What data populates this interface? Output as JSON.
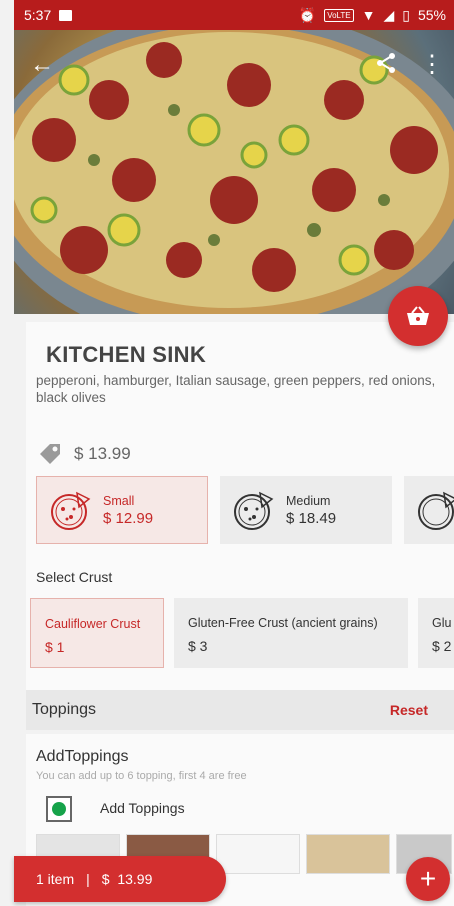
{
  "status_bar": {
    "time": "5:37",
    "volte": "VoLTE",
    "battery": "55%"
  },
  "header": {
    "back_icon": "arrow-back-icon",
    "share_icon": "share-icon",
    "more_icon": "more-vert-icon"
  },
  "product": {
    "name": "KITCHEN SINK",
    "description": "pepperoni, hamburger, Italian sausage, green peppers, red onions, black olives",
    "base_price": "$ 13.99"
  },
  "sizes": [
    {
      "name": "Small",
      "price": "$ 12.99",
      "selected": true
    },
    {
      "name": "Medium",
      "price": "$ 18.49",
      "selected": false
    },
    {
      "name": "",
      "price": "",
      "selected": false
    }
  ],
  "crust": {
    "label": "Select Crust",
    "options": [
      {
        "name": "Cauliflower Crust",
        "price": "$ 1",
        "selected": true
      },
      {
        "name": "Gluten-Free Crust (ancient grains)",
        "price": "$ 3",
        "selected": false
      },
      {
        "name": "Glu",
        "price": "$ 2",
        "selected": false
      }
    ]
  },
  "toppings": {
    "title": "Toppings",
    "reset_label": "Reset",
    "add_title": "AddToppings",
    "add_subtitle": "You can add up to 6 topping, first 4 are free",
    "add_label": "Add Toppings"
  },
  "cart": {
    "items": "1 item",
    "separator": "|",
    "total": "$  13.99"
  },
  "colors": {
    "accent": "#d32f2f",
    "status_bar": "#b71c1c",
    "checkbox": "#16a34a"
  }
}
